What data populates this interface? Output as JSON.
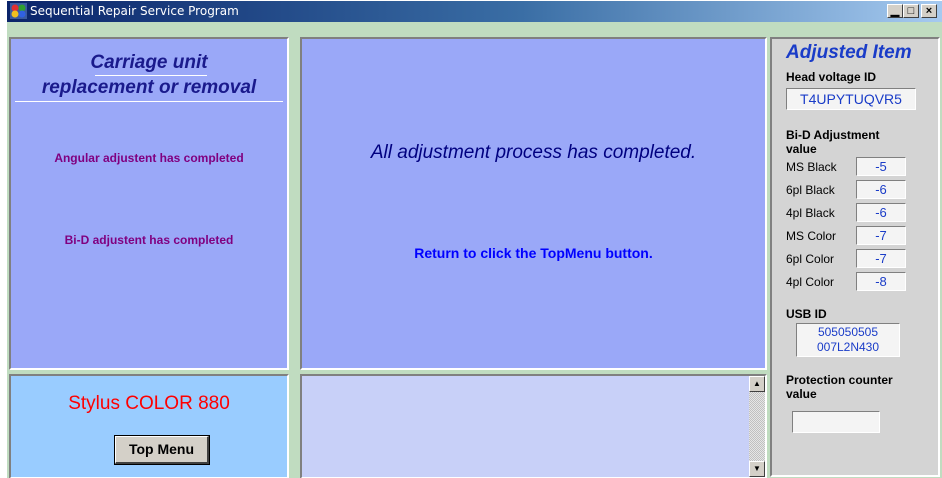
{
  "window": {
    "title": "Sequential Repair Service Program",
    "controls": {
      "minimize": "▁",
      "maximize": "□",
      "close": "×"
    }
  },
  "left_panel": {
    "title_line1": "Carriage unit",
    "title_line2": "replacement or removal",
    "angular_status": "Angular adjustent has completed",
    "bid_status": "Bi-D adjustent has completed"
  },
  "center_panel": {
    "main_message": "All adjustment process has completed.",
    "instruction": "Return to click the TopMenu button."
  },
  "model_panel": {
    "model_name": "Stylus COLOR 880",
    "top_menu_label": "Top Menu"
  },
  "adjusted_item": {
    "title": "Adjusted Item",
    "head_voltage_label": "Head voltage ID",
    "head_voltage_value": "T4UPYTUQVR5",
    "bid_label_line1": "Bi-D Adjustment",
    "bid_label_line2": "value",
    "bid_rows": [
      {
        "label": "MS Black",
        "value": "-5"
      },
      {
        "label": "6pl Black",
        "value": "-6"
      },
      {
        "label": "4pl Black",
        "value": "-6"
      },
      {
        "label": "MS Color",
        "value": "-7"
      },
      {
        "label": "6pl Color",
        "value": "-7"
      },
      {
        "label": "4pl Color",
        "value": "-8"
      }
    ],
    "usb_label": "USB ID",
    "usb_line1": "505050505",
    "usb_line2": "007L2N430",
    "protection_label_line1": "Protection counter",
    "protection_label_line2": "value",
    "protection_value": ""
  },
  "colors": {
    "panel_blue": "#9aa8f8",
    "model_panel_blue": "#99ccff",
    "status_purple": "#800080",
    "model_red": "#ff0000",
    "value_blue": "#1a3cc8"
  }
}
